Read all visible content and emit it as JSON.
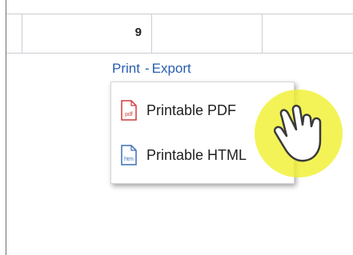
{
  "table": {
    "visible_cell_value": "9"
  },
  "links": {
    "print": "Print",
    "separator": "-",
    "export": "Export"
  },
  "print_menu": {
    "items": [
      {
        "label": "Printable PDF",
        "icon": "pdf-file-icon",
        "icon_text": "pdf",
        "icon_color": "#d23b3b"
      },
      {
        "label": "Printable HTML",
        "icon": "html-file-icon",
        "icon_text": "htm",
        "icon_color": "#3d6fb8"
      }
    ]
  },
  "cursor": {
    "icon": "hand-pointer-icon",
    "highlight_color": "#f0f028"
  }
}
